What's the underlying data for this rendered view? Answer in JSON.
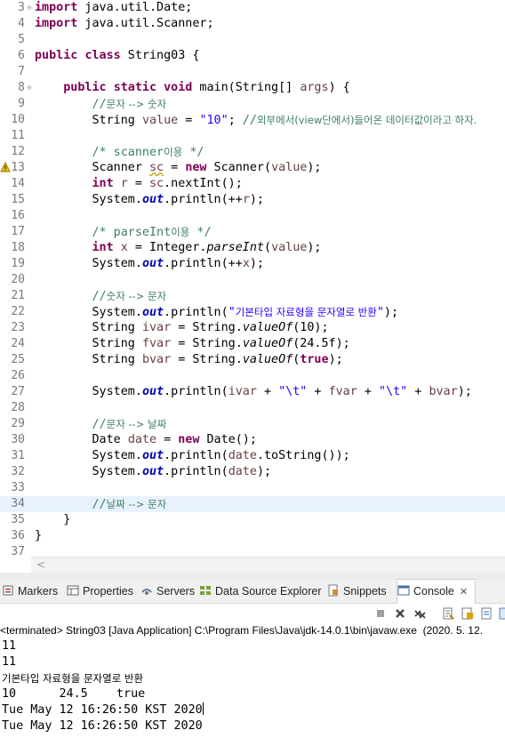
{
  "editor": {
    "lines": [
      {
        "n": "3",
        "fold": "⊖",
        "html": "<span class=\"kw\">import</span> java.util.Date;"
      },
      {
        "n": "4",
        "html": "<span class=\"kw\">import</span> java.util.Scanner;"
      },
      {
        "n": "5",
        "html": ""
      },
      {
        "n": "6",
        "html": "<span class=\"kw\">public</span> <span class=\"kw\">class</span> String03 {"
      },
      {
        "n": "7",
        "html": ""
      },
      {
        "n": "8",
        "fold": "⊖",
        "html": "    <span class=\"kw\">public</span> <span class=\"kw\">static</span> <span class=\"kw\">void</span> main(String[] <span class=\"var\">args</span>) {"
      },
      {
        "n": "9",
        "html": "        <span class=\"cm\">//<span class=\"kr\">문자 --&gt; 숫자</span></span>"
      },
      {
        "n": "10",
        "html": "        String <span class=\"var\">value</span> = <span class=\"str\">\"10\"</span>; <span class=\"cm\">//<span class=\"kr\">외부에서(view단에서)들어온 데이터값이라고 하자.</span></span>"
      },
      {
        "n": "11",
        "html": ""
      },
      {
        "n": "12",
        "html": "        <span class=\"cm\">/* scanner<span class=\"kr\">이용</span> */</span>"
      },
      {
        "n": "13",
        "warn": true,
        "html": "        Scanner <span class=\"var unused\">sc</span> = <span class=\"kw\">new</span> Scanner(<span class=\"var\">value</span>);"
      },
      {
        "n": "14",
        "html": "        <span class=\"kw\">int</span> <span class=\"var\">r</span> = <span class=\"var\">sc</span>.nextInt();"
      },
      {
        "n": "15",
        "html": "        System.<span class=\"fld\">out</span>.println(++<span class=\"var\">r</span>);"
      },
      {
        "n": "16",
        "html": ""
      },
      {
        "n": "17",
        "html": "        <span class=\"cm\">/* parseInt<span class=\"kr\">이용</span> */</span>"
      },
      {
        "n": "18",
        "html": "        <span class=\"kw\">int</span> <span class=\"var\">x</span> = Integer.<span class=\"stm\">parseInt</span>(<span class=\"var\">value</span>);"
      },
      {
        "n": "19",
        "html": "        System.<span class=\"fld\">out</span>.println(++<span class=\"var\">x</span>);"
      },
      {
        "n": "20",
        "html": ""
      },
      {
        "n": "21",
        "html": "        <span class=\"cm\">//<span class=\"kr\">숫자 --&gt; 문자</span></span>"
      },
      {
        "n": "22",
        "html": "        System.<span class=\"fld\">out</span>.println(<span class=\"str\">\"<span class=\"kr\">기본타입 자료형을 문자열로 반환</span>\"</span>);"
      },
      {
        "n": "23",
        "html": "        String <span class=\"var\">ivar</span> = String.<span class=\"stm\">valueOf</span>(10);"
      },
      {
        "n": "24",
        "html": "        String <span class=\"var\">fvar</span> = String.<span class=\"stm\">valueOf</span>(24.5f);"
      },
      {
        "n": "25",
        "html": "        String <span class=\"var\">bvar</span> = String.<span class=\"stm\">valueOf</span>(<span class=\"kw\">true</span>);"
      },
      {
        "n": "26",
        "html": ""
      },
      {
        "n": "27",
        "html": "        System.<span class=\"fld\">out</span>.println(<span class=\"var\">ivar</span> + <span class=\"str\">\"\\t\"</span> + <span class=\"var\">fvar</span> + <span class=\"str\">\"\\t\"</span> + <span class=\"var\">bvar</span>);"
      },
      {
        "n": "28",
        "html": ""
      },
      {
        "n": "29",
        "html": "        <span class=\"cm\">//<span class=\"kr\">문자 --&gt; 날짜</span></span>"
      },
      {
        "n": "30",
        "html": "        Date <span class=\"var\">date</span> = <span class=\"kw\">new</span> Date();"
      },
      {
        "n": "31",
        "html": "        System.<span class=\"fld\">out</span>.println(<span class=\"var\">date</span>.toString());"
      },
      {
        "n": "32",
        "html": "        System.<span class=\"fld\">out</span>.println(<span class=\"var\">date</span>);"
      },
      {
        "n": "33",
        "html": ""
      },
      {
        "n": "34",
        "current": true,
        "html": "        <span class=\"cm\">//<span class=\"kr\">날짜 --&gt; 문자</span></span>"
      },
      {
        "n": "35",
        "html": "    }"
      },
      {
        "n": "36",
        "html": "}"
      },
      {
        "n": "37",
        "html": ""
      }
    ],
    "scroll_left_arrow": "<"
  },
  "console_tabs": [
    {
      "label": "Markers",
      "icon": "markers-icon"
    },
    {
      "label": "Properties",
      "icon": "properties-icon"
    },
    {
      "label": "Servers",
      "icon": "servers-icon"
    },
    {
      "label": "Data Source Explorer",
      "icon": "data-source-icon"
    },
    {
      "label": "Snippets",
      "icon": "snippets-icon"
    },
    {
      "label": "Console",
      "icon": "console-icon",
      "active": true,
      "close": "✕"
    }
  ],
  "console": {
    "status": "<terminated> String03 [Java Application] C:\\Program Files\\Java\\jdk-14.0.1\\bin\\javaw.exe  (2020. 5. 12.",
    "output": [
      "11",
      "11",
      "기본타입 자료형을 문자열로 반환",
      "10\t24.5\ttrue",
      "Tue May 12 16:26:50 KST 2020",
      "Tue May 12 16:26:50 KST 2020"
    ]
  },
  "colors": {
    "keyword": "#7f0055",
    "comment": "#3f7f5f",
    "string": "#2a00ff",
    "field": "#0000c0",
    "current_line": "#e8f2fe"
  }
}
